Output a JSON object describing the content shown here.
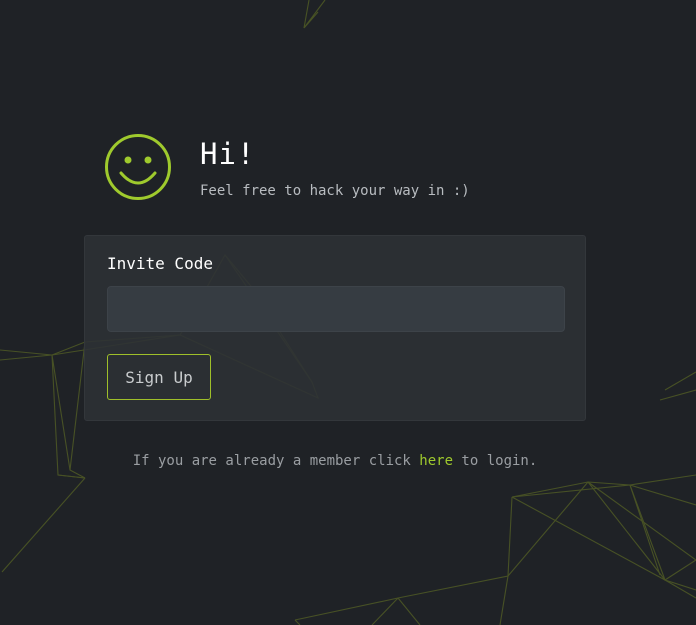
{
  "header": {
    "greeting": "Hi!",
    "subtitle": "Feel free to hack your way in :)"
  },
  "form": {
    "invite_label": "Invite Code",
    "invite_value": "",
    "invite_placeholder": "",
    "signup_label": "Sign Up"
  },
  "footer": {
    "before_link": "If you are already a member click ",
    "link_text": "here",
    "after_link": " to login."
  },
  "icons": {
    "logo": "smiley-face-icon"
  },
  "colors": {
    "background": "#1f2226",
    "accent": "#9fca2d",
    "card": "#2d3135",
    "input": "#363c42"
  }
}
